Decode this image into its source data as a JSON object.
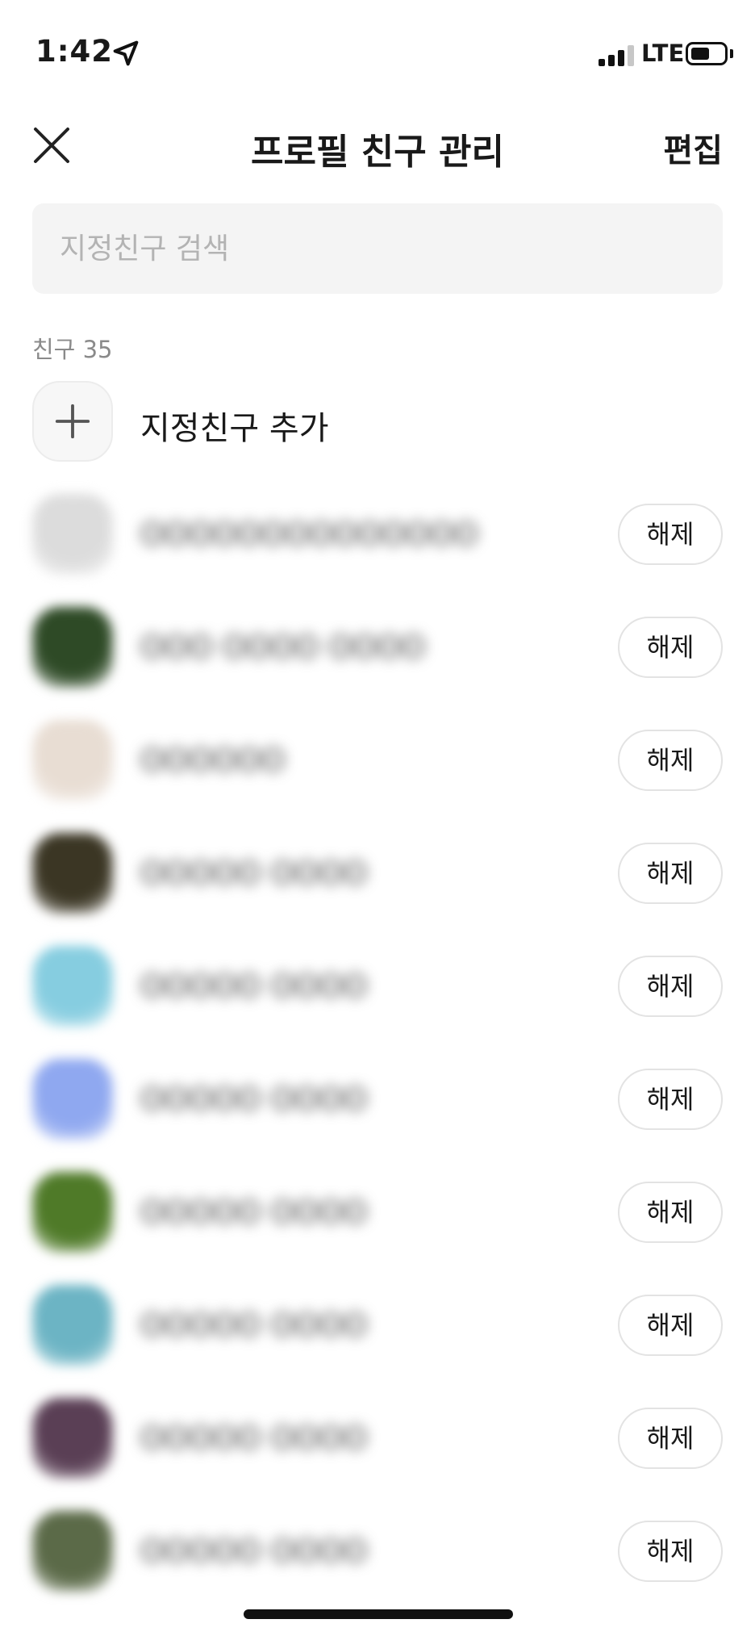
{
  "status_bar": {
    "time": "1:42",
    "network": "LTE"
  },
  "nav": {
    "title": "프로필 친구 관리",
    "edit_label": "편집"
  },
  "search": {
    "placeholder": "지정친구 검색",
    "value": ""
  },
  "section": {
    "label": "친구 35"
  },
  "add_friend": {
    "label": "지정친구 추가"
  },
  "friends": [
    {
      "name": "OOOOOOOOOOOOOO",
      "release_label": "해제",
      "avatar_color": "#dcdcdc"
    },
    {
      "name": "OOO OOOO OOOO",
      "release_label": "해제",
      "avatar_color": "#2e4a26"
    },
    {
      "name": "OOOOOO",
      "release_label": "해제",
      "avatar_color": "#e8ddd3"
    },
    {
      "name": "OOOOO OOOO",
      "release_label": "해제",
      "avatar_color": "#3b3624"
    },
    {
      "name": "OOOOO OOOO",
      "release_label": "해제",
      "avatar_color": "#86cde0"
    },
    {
      "name": "OOOOO OOOO",
      "release_label": "해제",
      "avatar_color": "#8fa8f0"
    },
    {
      "name": "OOOOO OOOO",
      "release_label": "해제",
      "avatar_color": "#4f7a28"
    },
    {
      "name": "OOOOO OOOO",
      "release_label": "해제",
      "avatar_color": "#6cb4c4"
    },
    {
      "name": "OOOOO OOOO",
      "release_label": "해제",
      "avatar_color": "#5a3f55"
    },
    {
      "name": "OOOOO OOOO",
      "release_label": "해제",
      "avatar_color": "#5b6a48"
    }
  ]
}
